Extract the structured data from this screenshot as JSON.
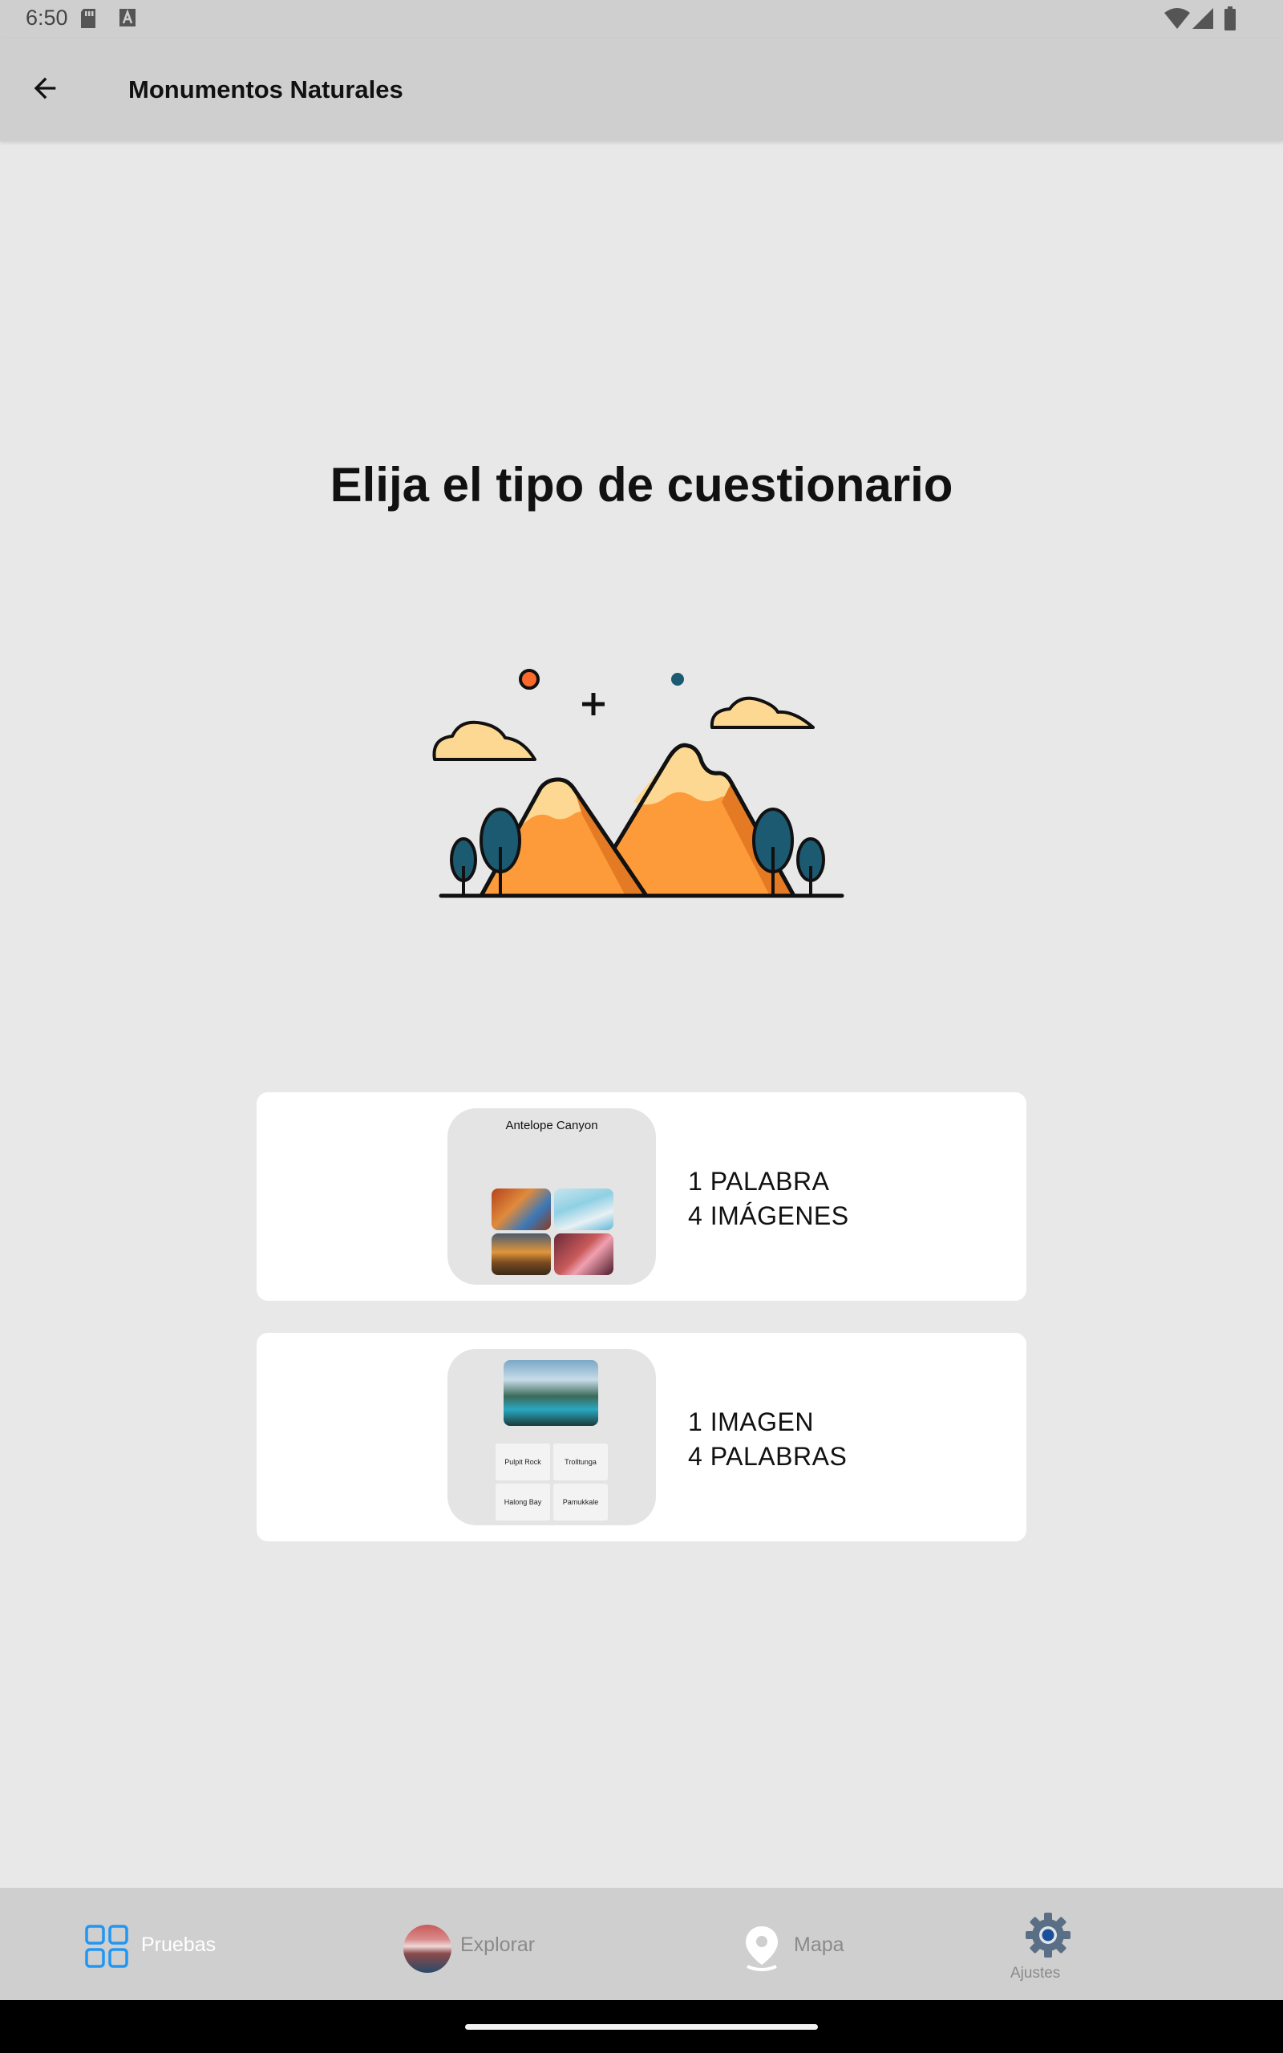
{
  "status_bar": {
    "time": "6:50"
  },
  "app_bar": {
    "title": "Monumentos Naturales"
  },
  "main": {
    "heading": "Elija el tipo de cuestionario",
    "cards": [
      {
        "line1": "1 PALABRA",
        "line2": "4 IMÁGENES",
        "thumb_title": "Antelope Canyon"
      },
      {
        "line1": "1 IMAGEN",
        "line2": "4 PALABRAS",
        "thumb_words": [
          "Pulpit Rock",
          "Trolltunga",
          "Halong Bay",
          "Pamukkale"
        ]
      }
    ]
  },
  "bottom_nav": {
    "items": [
      {
        "label": "Pruebas",
        "icon": "grid-icon",
        "active": true
      },
      {
        "label": "Explorar",
        "icon": "explore-photo-icon",
        "active": false
      },
      {
        "label": "Mapa",
        "icon": "map-pin-icon",
        "active": false
      },
      {
        "label": "Ajustes",
        "icon": "gear-icon",
        "active": false
      }
    ]
  },
  "colors": {
    "background": "#e8e8e8",
    "bar": "#cfcfcf",
    "accent": "#2196f3",
    "inactive": "#8a8a8a",
    "mountain": "#fd9a3a",
    "tree": "#1c5a72"
  }
}
